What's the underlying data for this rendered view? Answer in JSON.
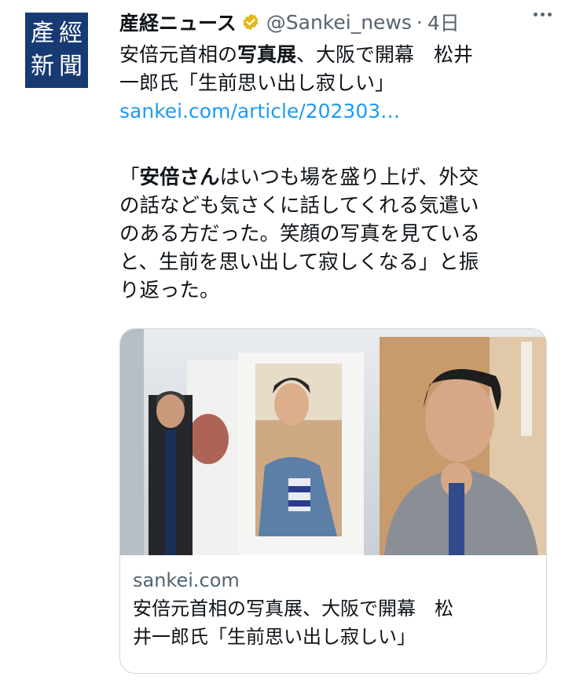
{
  "avatar": {
    "chars": [
      "產",
      "經",
      "新",
      "聞"
    ]
  },
  "header": {
    "display_name": "産経ニュース",
    "handle": "@Sankei_news",
    "separator": "·",
    "time": "4日"
  },
  "tweet": {
    "line1_pre": "安倍元首相の",
    "line1_bold": "写真展",
    "line1_post": "、大阪で開幕　松井",
    "line2": "一郎氏「生前思い出し寂しい」",
    "link": "sankei.com/article/202303…"
  },
  "quote": {
    "line1_pre": "「",
    "line1_bold": "安倍さん",
    "line1_post": "はいつも場を盛り上げ、外交",
    "line2": "の話なども気さくに話してくれる気遣い",
    "line3": "のある方だった。笑顔の写真を見ている",
    "line4": "と、生前を思い出して寂しくなる」と振",
    "line5": "り返った。"
  },
  "card": {
    "domain": "sankei.com",
    "title_line1": "安倍元首相の写真展、大阪で開幕　松",
    "title_line2": "井一郎氏「生前思い出し寂しい」"
  },
  "colors": {
    "link": "#1d9bf0",
    "secondary": "#536471",
    "avatar_bg": "#173a73",
    "verified": "#e2b719"
  },
  "icons": [
    "verified-badge-icon",
    "more-options-icon"
  ]
}
